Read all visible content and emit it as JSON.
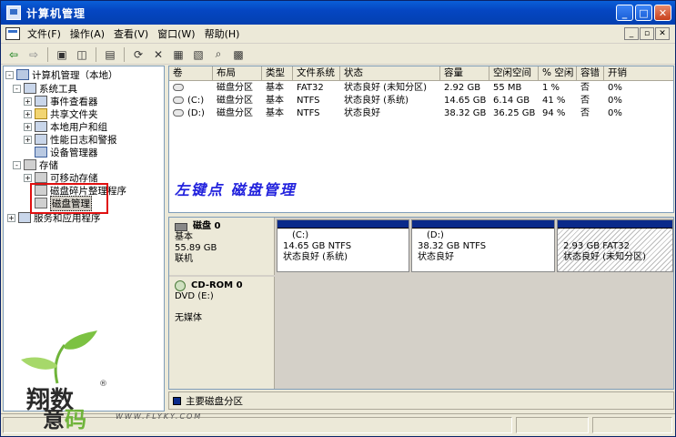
{
  "window": {
    "title": "计算机管理",
    "minimize": "_",
    "maximize": "□",
    "close": "✕"
  },
  "menu": {
    "items": [
      "文件(F)",
      "操作(A)",
      "查看(V)",
      "窗口(W)",
      "帮助(H)"
    ],
    "mdi": [
      "_",
      "▫",
      "✕"
    ]
  },
  "toolbar": {
    "icons": [
      "back-arrow-icon",
      "forward-arrow-icon",
      "up-folder-icon",
      "show-tree-icon",
      "properties-icon",
      "refresh-icon",
      "delete-icon",
      "export-icon",
      "open-icon",
      "search-icon",
      "view-icon"
    ]
  },
  "tree": {
    "root": "计算机管理（本地）",
    "system_tools": "系统工具",
    "event_viewer": "事件查看器",
    "shared_folders": "共享文件夹",
    "local_users": "本地用户和组",
    "perf_logs": "性能日志和警报",
    "device_manager": "设备管理器",
    "storage": "存储",
    "removable": "可移动存储",
    "defrag": "磁盘碎片整理程序",
    "disk_mgmt": "磁盘管理",
    "services": "服务和应用程序"
  },
  "volumes": {
    "headers": [
      "卷",
      "布局",
      "类型",
      "文件系统",
      "状态",
      "容量",
      "空闲空间",
      "% 空闲",
      "容错",
      "开销"
    ],
    "rows": [
      [
        "",
        "磁盘分区",
        "基本",
        "FAT32",
        "状态良好 (未知分区)",
        "2.92 GB",
        "55 MB",
        "1 %",
        "否",
        "0%"
      ],
      [
        "(C:)",
        "磁盘分区",
        "基本",
        "NTFS",
        "状态良好 (系统)",
        "14.65 GB",
        "6.14 GB",
        "41 %",
        "否",
        "0%"
      ],
      [
        "(D:)",
        "磁盘分区",
        "基本",
        "NTFS",
        "状态良好",
        "38.32 GB",
        "36.25 GB",
        "94 %",
        "否",
        "0%"
      ]
    ]
  },
  "annotation": "左键点 磁盘管理",
  "disk0": {
    "name": "磁盘 0",
    "type": "基本",
    "size": "55.89 GB",
    "status": "联机",
    "parts": [
      {
        "label": "(C:)",
        "info": "14.65 GB NTFS",
        "status": "状态良好 (系统)"
      },
      {
        "label": "(D:)",
        "info": "38.32 GB NTFS",
        "status": "状态良好"
      },
      {
        "label": "",
        "info": "2.93 GB FAT32",
        "status": "状态良好 (未知分区)"
      }
    ]
  },
  "cdrom0": {
    "name": "CD-ROM 0",
    "drive": "DVD (E:)",
    "media": "无媒体"
  },
  "legend": {
    "primary": "主要磁盘分区"
  },
  "watermark": {
    "brand_top": "翔数",
    "brand_bottom_a": "意",
    "brand_bottom_b": "码",
    "reg": "®",
    "url": "WWW.FLYKY.COM"
  },
  "colors": {
    "primary_partition": "#0a2a8a",
    "highlight": "#e01010",
    "annotation": "#2222dd"
  }
}
